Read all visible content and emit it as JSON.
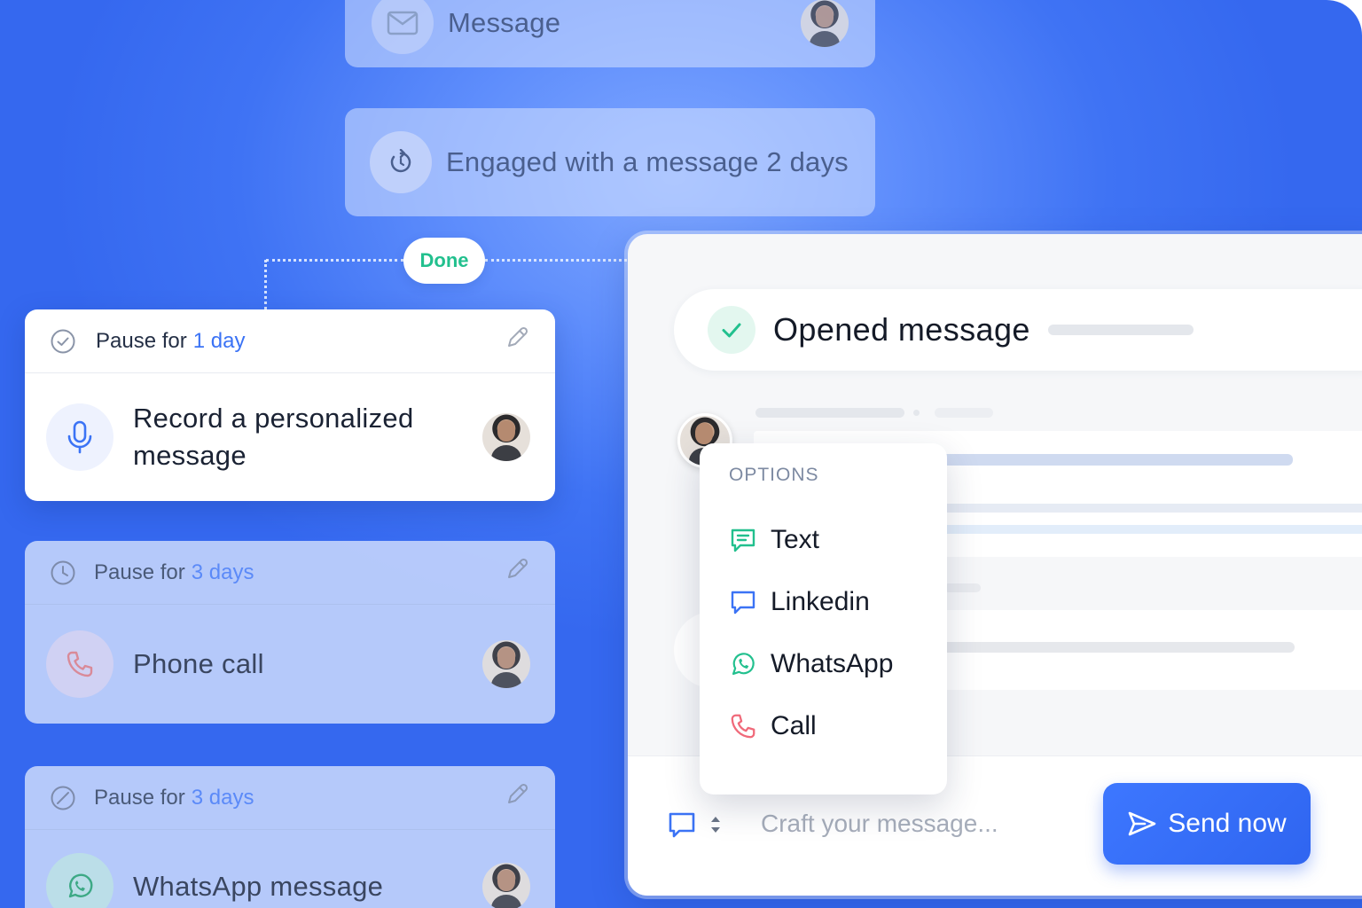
{
  "flow": {
    "message_label": "Message",
    "engaged_label": "Engaged with a message 2 days",
    "done_label": "Done"
  },
  "steps": [
    {
      "pause_prefix": "Pause for",
      "pause_value": "1 day",
      "action_label": "Record a personalized message",
      "icon": "microphone-icon",
      "state": "active"
    },
    {
      "pause_prefix": "Pause for",
      "pause_value": "3 days",
      "action_label": "Phone call",
      "icon": "phone-icon",
      "state": "faded"
    },
    {
      "pause_prefix": "Pause for",
      "pause_value": "3 days",
      "action_label": "WhatsApp message",
      "icon": "whatsapp-icon",
      "state": "faded"
    }
  ],
  "panel": {
    "status_title": "Opened message",
    "options": {
      "title": "OPTIONS",
      "items": [
        {
          "label": "Text",
          "icon": "text-message-icon",
          "color": "#22c08e"
        },
        {
          "label": "Linkedin",
          "icon": "linkedin-chat-icon",
          "color": "#3b73f5"
        },
        {
          "label": "WhatsApp",
          "icon": "whatsapp-icon",
          "color": "#22c08e"
        },
        {
          "label": "Call",
          "icon": "phone-icon",
          "color": "#f06a7a"
        }
      ]
    },
    "composer": {
      "placeholder": "Craft your message...",
      "send_label": "Send now"
    }
  },
  "colors": {
    "accent": "#3b73f5",
    "success": "#22c08e",
    "background": "#3f73f4"
  }
}
